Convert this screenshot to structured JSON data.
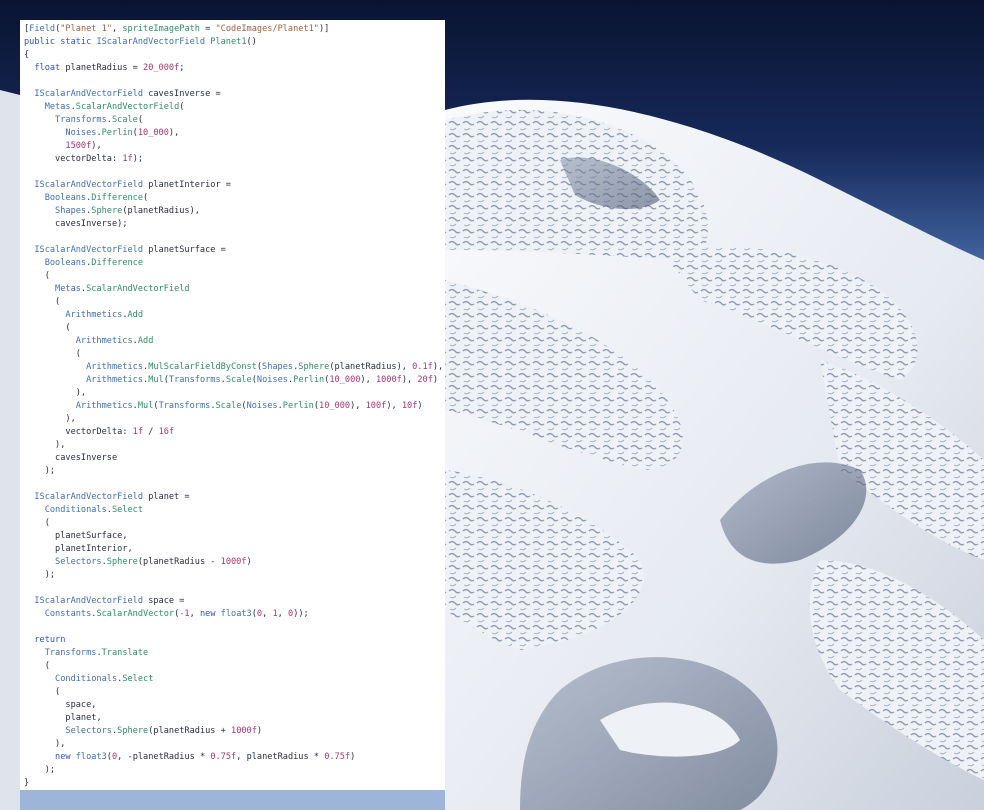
{
  "colors": {
    "background_sky_top": "#0a1431",
    "background_sky_bottom": "#6f8fbf",
    "surface": "#f1f3f7",
    "code_panel": "#ffffff",
    "type_name": "#3f6fb3",
    "method_name": "#2e8f66",
    "keyword": "#2f52c9",
    "string_literal": "#a3603b",
    "number_literal": "#b0336f",
    "identifier": "#2a2e45"
  },
  "render": {
    "semantic": "procedural-planet-render-with-caves",
    "surface_description_icon": "white-porous-rock-surface"
  },
  "code": {
    "language": "C#",
    "lines": [
      [
        [
          "punc",
          "["
        ],
        [
          "cls",
          "Field"
        ],
        [
          "punc",
          "("
        ],
        [
          "str",
          "\"Planet 1\""
        ],
        [
          "punc",
          ", "
        ],
        [
          "meth",
          "spriteImagePath"
        ],
        [
          "punc",
          " = "
        ],
        [
          "str",
          "\"CodeImages/Planet1\""
        ],
        [
          "punc",
          ")]"
        ]
      ],
      [
        [
          "kw",
          "public static "
        ],
        [
          "cls",
          "IScalarAndVectorField"
        ],
        [
          "punc",
          " "
        ],
        [
          "meth",
          "Planet1"
        ],
        [
          "punc",
          "()"
        ]
      ],
      [
        [
          "punc",
          "{"
        ]
      ],
      [
        [
          "kw",
          "  float "
        ],
        [
          "id",
          "planetRadius"
        ],
        [
          "punc",
          " = "
        ],
        [
          "num",
          "20_000f"
        ],
        [
          "punc",
          ";"
        ]
      ],
      [
        [
          "punc",
          ""
        ]
      ],
      [
        [
          "cls",
          "  IScalarAndVectorField "
        ],
        [
          "id",
          "cavesInverse"
        ],
        [
          "punc",
          " ="
        ]
      ],
      [
        [
          "cls",
          "    Metas"
        ],
        [
          "punc",
          "."
        ],
        [
          "meth",
          "ScalarAndVectorField"
        ],
        [
          "punc",
          "("
        ]
      ],
      [
        [
          "cls",
          "      Transforms"
        ],
        [
          "punc",
          "."
        ],
        [
          "meth",
          "Scale"
        ],
        [
          "punc",
          "("
        ]
      ],
      [
        [
          "cls",
          "        Noises"
        ],
        [
          "punc",
          "."
        ],
        [
          "meth",
          "Perlin"
        ],
        [
          "punc",
          "("
        ],
        [
          "num",
          "10_000"
        ],
        [
          "punc",
          "),"
        ]
      ],
      [
        [
          "num",
          "        1500f"
        ],
        [
          "punc",
          "),"
        ]
      ],
      [
        [
          "id",
          "      vectorDelta"
        ],
        [
          "punc",
          ": "
        ],
        [
          "num",
          "1f"
        ],
        [
          "punc",
          ");"
        ]
      ],
      [
        [
          "punc",
          ""
        ]
      ],
      [
        [
          "cls",
          "  IScalarAndVectorField "
        ],
        [
          "id",
          "planetInterior"
        ],
        [
          "punc",
          " ="
        ]
      ],
      [
        [
          "cls",
          "    Booleans"
        ],
        [
          "punc",
          "."
        ],
        [
          "meth",
          "Difference"
        ],
        [
          "punc",
          "("
        ]
      ],
      [
        [
          "cls",
          "      Shapes"
        ],
        [
          "punc",
          "."
        ],
        [
          "meth",
          "Sphere"
        ],
        [
          "punc",
          "("
        ],
        [
          "id",
          "planetRadius"
        ],
        [
          "punc",
          "),"
        ]
      ],
      [
        [
          "id",
          "      cavesInverse"
        ],
        [
          "punc",
          ");"
        ]
      ],
      [
        [
          "punc",
          ""
        ]
      ],
      [
        [
          "cls",
          "  IScalarAndVectorField "
        ],
        [
          "id",
          "planetSurface"
        ],
        [
          "punc",
          " ="
        ]
      ],
      [
        [
          "cls",
          "    Booleans"
        ],
        [
          "punc",
          "."
        ],
        [
          "meth",
          "Difference"
        ]
      ],
      [
        [
          "punc",
          "    ("
        ]
      ],
      [
        [
          "cls",
          "      Metas"
        ],
        [
          "punc",
          "."
        ],
        [
          "meth",
          "ScalarAndVectorField"
        ]
      ],
      [
        [
          "punc",
          "      ("
        ]
      ],
      [
        [
          "cls",
          "        Arithmetics"
        ],
        [
          "punc",
          "."
        ],
        [
          "meth",
          "Add"
        ]
      ],
      [
        [
          "punc",
          "        ("
        ]
      ],
      [
        [
          "cls",
          "          Arithmetics"
        ],
        [
          "punc",
          "."
        ],
        [
          "meth",
          "Add"
        ]
      ],
      [
        [
          "punc",
          "          ("
        ]
      ],
      [
        [
          "cls",
          "            Arithmetics"
        ],
        [
          "punc",
          "."
        ],
        [
          "meth",
          "MulScalarFieldByConst"
        ],
        [
          "punc",
          "("
        ],
        [
          "cls",
          "Shapes"
        ],
        [
          "punc",
          "."
        ],
        [
          "meth",
          "Sphere"
        ],
        [
          "punc",
          "("
        ],
        [
          "id",
          "planetRadius"
        ],
        [
          "punc",
          "), "
        ],
        [
          "num",
          "0.1f"
        ],
        [
          "punc",
          "),"
        ]
      ],
      [
        [
          "cls",
          "            Arithmetics"
        ],
        [
          "punc",
          "."
        ],
        [
          "meth",
          "Mul"
        ],
        [
          "punc",
          "("
        ],
        [
          "cls",
          "Transforms"
        ],
        [
          "punc",
          "."
        ],
        [
          "meth",
          "Scale"
        ],
        [
          "punc",
          "("
        ],
        [
          "cls",
          "Noises"
        ],
        [
          "punc",
          "."
        ],
        [
          "meth",
          "Perlin"
        ],
        [
          "punc",
          "("
        ],
        [
          "num",
          "10_000"
        ],
        [
          "punc",
          "), "
        ],
        [
          "num",
          "1000f"
        ],
        [
          "punc",
          "), "
        ],
        [
          "num",
          "20f"
        ],
        [
          "punc",
          ")"
        ]
      ],
      [
        [
          "punc",
          "          ),"
        ]
      ],
      [
        [
          "cls",
          "          Arithmetics"
        ],
        [
          "punc",
          "."
        ],
        [
          "meth",
          "Mul"
        ],
        [
          "punc",
          "("
        ],
        [
          "cls",
          "Transforms"
        ],
        [
          "punc",
          "."
        ],
        [
          "meth",
          "Scale"
        ],
        [
          "punc",
          "("
        ],
        [
          "cls",
          "Noises"
        ],
        [
          "punc",
          "."
        ],
        [
          "meth",
          "Perlin"
        ],
        [
          "punc",
          "("
        ],
        [
          "num",
          "10_000"
        ],
        [
          "punc",
          "), "
        ],
        [
          "num",
          "100f"
        ],
        [
          "punc",
          "), "
        ],
        [
          "num",
          "10f"
        ],
        [
          "punc",
          ")"
        ]
      ],
      [
        [
          "punc",
          "        ),"
        ]
      ],
      [
        [
          "id",
          "        vectorDelta"
        ],
        [
          "punc",
          ": "
        ],
        [
          "num",
          "1f"
        ],
        [
          "punc",
          " / "
        ],
        [
          "num",
          "16f"
        ]
      ],
      [
        [
          "punc",
          "      ),"
        ]
      ],
      [
        [
          "id",
          "      cavesInverse"
        ]
      ],
      [
        [
          "punc",
          "    );"
        ]
      ],
      [
        [
          "punc",
          ""
        ]
      ],
      [
        [
          "cls",
          "  IScalarAndVectorField "
        ],
        [
          "id",
          "planet"
        ],
        [
          "punc",
          " ="
        ]
      ],
      [
        [
          "cls",
          "    Conditionals"
        ],
        [
          "punc",
          "."
        ],
        [
          "meth",
          "Select"
        ]
      ],
      [
        [
          "punc",
          "    ("
        ]
      ],
      [
        [
          "id",
          "      planetSurface"
        ],
        [
          "punc",
          ","
        ]
      ],
      [
        [
          "id",
          "      planetInterior"
        ],
        [
          "punc",
          ","
        ]
      ],
      [
        [
          "cls",
          "      Selectors"
        ],
        [
          "punc",
          "."
        ],
        [
          "meth",
          "Sphere"
        ],
        [
          "punc",
          "("
        ],
        [
          "id",
          "planetRadius"
        ],
        [
          "punc",
          " - "
        ],
        [
          "num",
          "1000f"
        ],
        [
          "punc",
          ")"
        ]
      ],
      [
        [
          "punc",
          "    );"
        ]
      ],
      [
        [
          "punc",
          ""
        ]
      ],
      [
        [
          "cls",
          "  IScalarAndVectorField "
        ],
        [
          "id",
          "space"
        ],
        [
          "punc",
          " ="
        ]
      ],
      [
        [
          "cls",
          "    Constants"
        ],
        [
          "punc",
          "."
        ],
        [
          "meth",
          "ScalarAndVector"
        ],
        [
          "punc",
          "("
        ],
        [
          "num",
          "-1"
        ],
        [
          "punc",
          ", "
        ],
        [
          "kw",
          "new "
        ],
        [
          "cls",
          "float3"
        ],
        [
          "punc",
          "("
        ],
        [
          "num",
          "0"
        ],
        [
          "punc",
          ", "
        ],
        [
          "num",
          "1"
        ],
        [
          "punc",
          ", "
        ],
        [
          "num",
          "0"
        ],
        [
          "punc",
          "));"
        ]
      ],
      [
        [
          "punc",
          ""
        ]
      ],
      [
        [
          "kw",
          "  return"
        ]
      ],
      [
        [
          "cls",
          "    Transforms"
        ],
        [
          "punc",
          "."
        ],
        [
          "meth",
          "Translate"
        ]
      ],
      [
        [
          "punc",
          "    ("
        ]
      ],
      [
        [
          "cls",
          "      Conditionals"
        ],
        [
          "punc",
          "."
        ],
        [
          "meth",
          "Select"
        ]
      ],
      [
        [
          "punc",
          "      ("
        ]
      ],
      [
        [
          "id",
          "        space"
        ],
        [
          "punc",
          ","
        ]
      ],
      [
        [
          "id",
          "        planet"
        ],
        [
          "punc",
          ","
        ]
      ],
      [
        [
          "cls",
          "        Selectors"
        ],
        [
          "punc",
          "."
        ],
        [
          "meth",
          "Sphere"
        ],
        [
          "punc",
          "("
        ],
        [
          "id",
          "planetRadius"
        ],
        [
          "punc",
          " + "
        ],
        [
          "num",
          "1000f"
        ],
        [
          "punc",
          ")"
        ]
      ],
      [
        [
          "punc",
          "      ),"
        ]
      ],
      [
        [
          "kw",
          "      new "
        ],
        [
          "cls",
          "float3"
        ],
        [
          "punc",
          "("
        ],
        [
          "num",
          "0"
        ],
        [
          "punc",
          ", -"
        ],
        [
          "id",
          "planetRadius"
        ],
        [
          "punc",
          " * "
        ],
        [
          "num",
          "0.75f"
        ],
        [
          "punc",
          ", "
        ],
        [
          "id",
          "planetRadius"
        ],
        [
          "punc",
          " * "
        ],
        [
          "num",
          "0.75f"
        ],
        [
          "punc",
          ")"
        ]
      ],
      [
        [
          "punc",
          "    );"
        ]
      ],
      [
        [
          "punc",
          "}"
        ]
      ]
    ]
  }
}
